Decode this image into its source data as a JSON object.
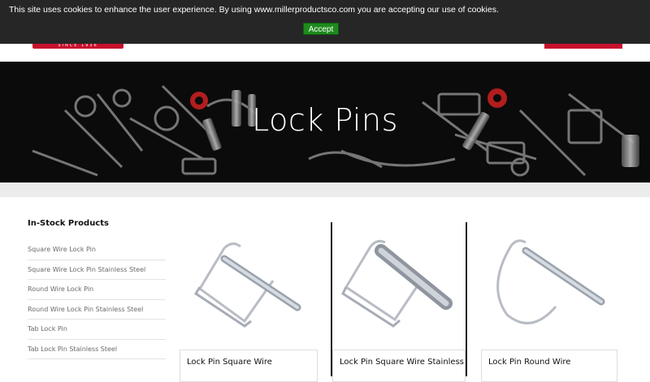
{
  "cookie": {
    "message": "This site uses cookies to enhance the user experience. By using www.millerproductsco.com you are accepting our use of cookies.",
    "accept_label": "Accept"
  },
  "header": {
    "logo_tagline": "SINCE 1936"
  },
  "hero": {
    "title": "Lock Pins"
  },
  "sidebar": {
    "title": "In-Stock Products",
    "items": [
      "Square Wire Lock Pin",
      "Square Wire Lock Pin Stainless Steel",
      "Round Wire Lock Pin",
      "Round Wire Lock Pin Stainless Steel",
      "Tab Lock Pin",
      "Tab Lock Pin Stainless Steel"
    ]
  },
  "products": [
    {
      "name": "Lock Pin Square Wire"
    },
    {
      "name": "Lock Pin Square Wire Stainless"
    },
    {
      "name": "Lock Pin Round Wire"
    }
  ],
  "colors": {
    "brand_red": "#c8102e",
    "cookie_bg": "#262626",
    "accept_green": "#1e8a1e"
  }
}
